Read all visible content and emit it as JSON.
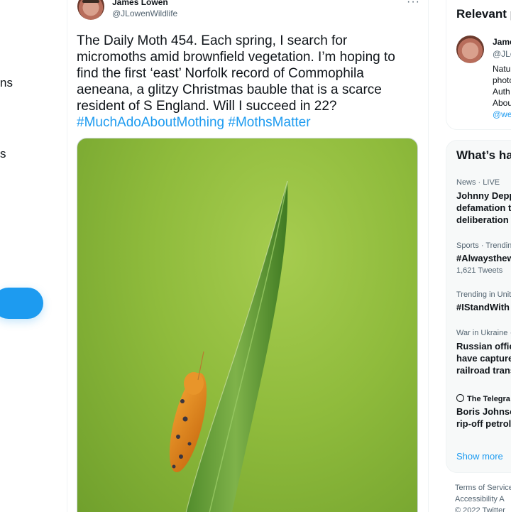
{
  "nav": {
    "fragment_1": "ns",
    "fragment_2": "s"
  },
  "tweet": {
    "author_name": "James Lowen",
    "author_handle": "@JLowenWildlife",
    "more_label": "···",
    "text_lines": [
      "The Daily Moth 454. Each spring, I search for",
      "micromoths amid brownfield vegetation. I’m hoping to",
      "find the first ‘east’ Norfolk record of Commophila",
      "aeneana, a glitzy Christmas bauble that is a scarce",
      "resident of S England. Will I succeed in 22?"
    ],
    "hashtags": [
      "#MuchAdoAboutMothing",
      "#MothsMatter"
    ]
  },
  "relevant": {
    "title": "Relevant p",
    "name": "Jame",
    "handle": "@JLo",
    "bio_lines": [
      "Natu",
      "photo",
      "Auth",
      "Abou"
    ],
    "link": "@we"
  },
  "trends": {
    "title": "What’s ha",
    "items": [
      {
        "meta": "News · LIVE",
        "title_lines": [
          "Johnny Depp",
          "defamation t",
          "deliberation"
        ],
        "count": ""
      },
      {
        "meta": "Sports · Trendin",
        "title_lines": [
          "#Alwaysthew"
        ],
        "count": "1,621 Tweets"
      },
      {
        "meta": "Trending in Unit",
        "title_lines": [
          "#IStandWith"
        ],
        "count": ""
      },
      {
        "meta": "War in Ukraine ·",
        "title_lines": [
          "Russian offic",
          "have capture",
          "railroad trans"
        ],
        "count": ""
      },
      {
        "meta": "The Telegra",
        "title_lines": [
          "Boris Johnso",
          "rip-off petrol"
        ],
        "count": ""
      }
    ],
    "show_more": "Show more"
  },
  "footer": {
    "line1": "Terms of Service",
    "line2": "Accessibility  A",
    "line3": "© 2022 Twitter"
  },
  "colors": {
    "accent": "#1d9bf0",
    "text": "#0f1419",
    "muted": "#536471"
  }
}
